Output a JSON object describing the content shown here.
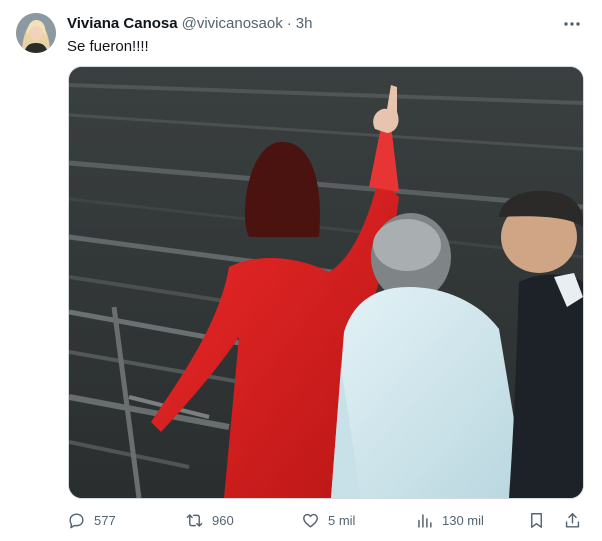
{
  "tweet": {
    "author_name": "Viviana Canosa",
    "handle": "@vivicanosaok",
    "separator": "·",
    "time": "3h",
    "text": "Se fueron!!!!",
    "media_description_icon": "photo"
  },
  "actions": {
    "replies": "577",
    "retweets": "960",
    "likes": "5 mil",
    "views": "130 mil"
  },
  "icons": {
    "more": "more-horizontal-icon",
    "reply": "reply-icon",
    "retweet": "retweet-icon",
    "like": "heart-icon",
    "views": "views-chart-icon",
    "bookmark": "bookmark-icon",
    "share": "share-icon"
  },
  "colors": {
    "text_primary": "#0f1419",
    "text_secondary": "#536471",
    "red_dress": "#d81e1e",
    "light_blue_shirt": "#cfe7ef"
  }
}
